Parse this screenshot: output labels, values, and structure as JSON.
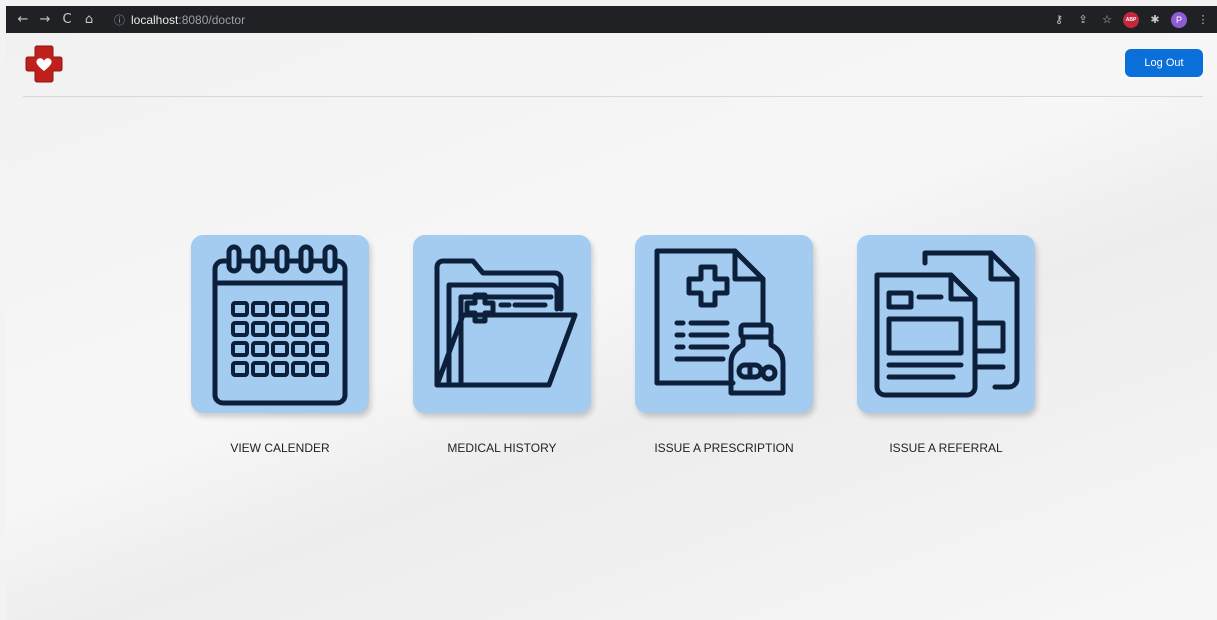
{
  "browser": {
    "url_host": "localhost",
    "url_path": ":8080/doctor",
    "abp_badge": "ABP",
    "profile_initial": "P"
  },
  "header": {
    "logout_label": "Log Out",
    "logo_color": "#c0201c"
  },
  "tiles": [
    {
      "label": "VIEW CALENDER",
      "icon": "calendar-icon"
    },
    {
      "label": "MEDICAL HISTORY",
      "icon": "medical-folder-icon"
    },
    {
      "label": "ISSUE A PRESCRIPTION",
      "icon": "prescription-icon"
    },
    {
      "label": "ISSUE A REFERRAL",
      "icon": "referral-documents-icon"
    }
  ],
  "colors": {
    "tile_bg": "#a4cbf0",
    "icon_stroke": "#0c1f3b",
    "button_bg": "#0b6fd9"
  }
}
